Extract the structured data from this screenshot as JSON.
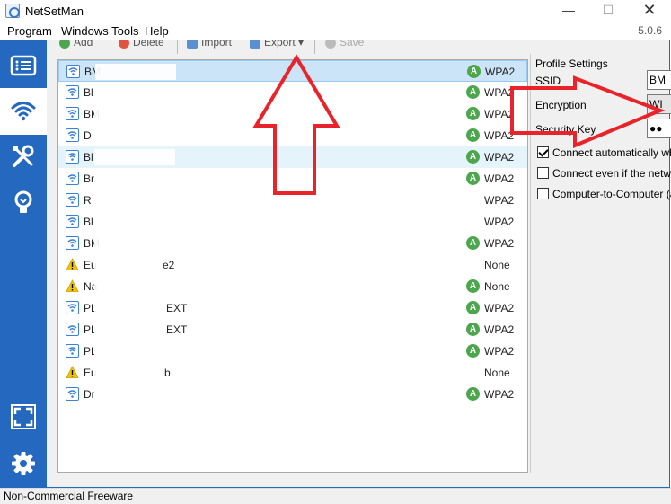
{
  "window": {
    "title": "NetSetMan",
    "version": "5.0.6"
  },
  "menu": {
    "program": "Program",
    "windows_tools": "Windows Tools",
    "help": "Help"
  },
  "toolbar": {
    "add": "Add",
    "delete": "Delete",
    "import": "Import",
    "export": "Export",
    "save": "Save"
  },
  "profiles": [
    {
      "icon": "wifi-icon",
      "name": "BM",
      "auto": true,
      "encryption": "WPA2"
    },
    {
      "icon": "wifi-icon",
      "name": "Bl",
      "auto": true,
      "encryption": "WPA2"
    },
    {
      "icon": "wifi-icon",
      "name": "BM",
      "auto": true,
      "encryption": "WPA2"
    },
    {
      "icon": "wifi-icon",
      "name": "D",
      "auto": true,
      "encryption": "WPA2"
    },
    {
      "icon": "wifi-icon",
      "name": "Bl",
      "auto": true,
      "encryption": "WPA2"
    },
    {
      "icon": "wifi-icon",
      "name": "Br",
      "auto": true,
      "encryption": "WPA2"
    },
    {
      "icon": "wifi-icon",
      "name": "R",
      "auto": false,
      "encryption": "WPA2"
    },
    {
      "icon": "wifi-icon",
      "name": "Bl",
      "auto": false,
      "encryption": "WPA2"
    },
    {
      "icon": "wifi-icon",
      "name": "BM",
      "auto": true,
      "encryption": "WPA2"
    },
    {
      "icon": "warning-icon",
      "name": "Eu",
      "tail": "e2",
      "auto": false,
      "encryption": "None"
    },
    {
      "icon": "warning-icon",
      "name": "Na",
      "auto": true,
      "encryption": "None"
    },
    {
      "icon": "wifi-icon",
      "name": "PL",
      "tail": "EXT",
      "auto": true,
      "encryption": "WPA2"
    },
    {
      "icon": "wifi-icon",
      "name": "PL",
      "tail": "EXT",
      "auto": true,
      "encryption": "WPA2"
    },
    {
      "icon": "wifi-icon",
      "name": "PL",
      "auto": true,
      "encryption": "WPA2"
    },
    {
      "icon": "warning-icon",
      "name": "Eu",
      "tail": "b",
      "auto": false,
      "encryption": "None"
    },
    {
      "icon": "wifi-icon",
      "name": "Dr",
      "auto": true,
      "encryption": "WPA2"
    }
  ],
  "auto_badge": "A",
  "profile_settings": {
    "title": "Profile Settings",
    "ssid_label": "SSID",
    "ssid_value": "BM",
    "encryption_label": "Encryption",
    "encryption_value": "WI",
    "security_key_label": "Security Key",
    "security_key_value": "●●",
    "connect_auto": "Connect automatically wh",
    "connect_even": "Connect even if the netw",
    "computer_to_computer": "Computer-to-Computer (a"
  },
  "status": {
    "text": "Non-Commercial Freeware"
  },
  "colors": {
    "sidebar": "#2468c0",
    "accent": "#1c6fbf",
    "annotation_arrow": "#e8232a",
    "auto_badge": "#4ca64c"
  }
}
